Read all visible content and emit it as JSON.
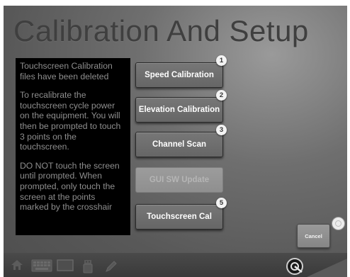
{
  "title": "Calibration And Setup",
  "info_panel": {
    "paragraphs": [
      "Touchscreen Calibration files have been deleted",
      "To recalibrate the touchscreen cycle power on the equipment.  You will then be prompted to touch 3 points on the touchscreen.",
      "DO NOT touch the screen until prompted.  When prompted, only touch the screen at the points marked by the crosshair"
    ]
  },
  "buttons": [
    {
      "label": "Speed Calibration",
      "badge": "1",
      "enabled": true
    },
    {
      "label": "Elevation Calibration",
      "badge": "2",
      "enabled": true
    },
    {
      "label": "Channel Scan",
      "badge": "3",
      "enabled": true
    },
    {
      "label": "GUI SW Update",
      "badge": "",
      "enabled": false
    },
    {
      "label": "Touchscreen Cal",
      "badge": "5",
      "enabled": true
    }
  ],
  "cancel": {
    "label": "Cancel"
  },
  "taskbar": {
    "icons": [
      "home-icon",
      "keyboard-icon",
      "monitor-icon",
      "usb-icon",
      "pen-icon",
      "power-icon"
    ]
  }
}
